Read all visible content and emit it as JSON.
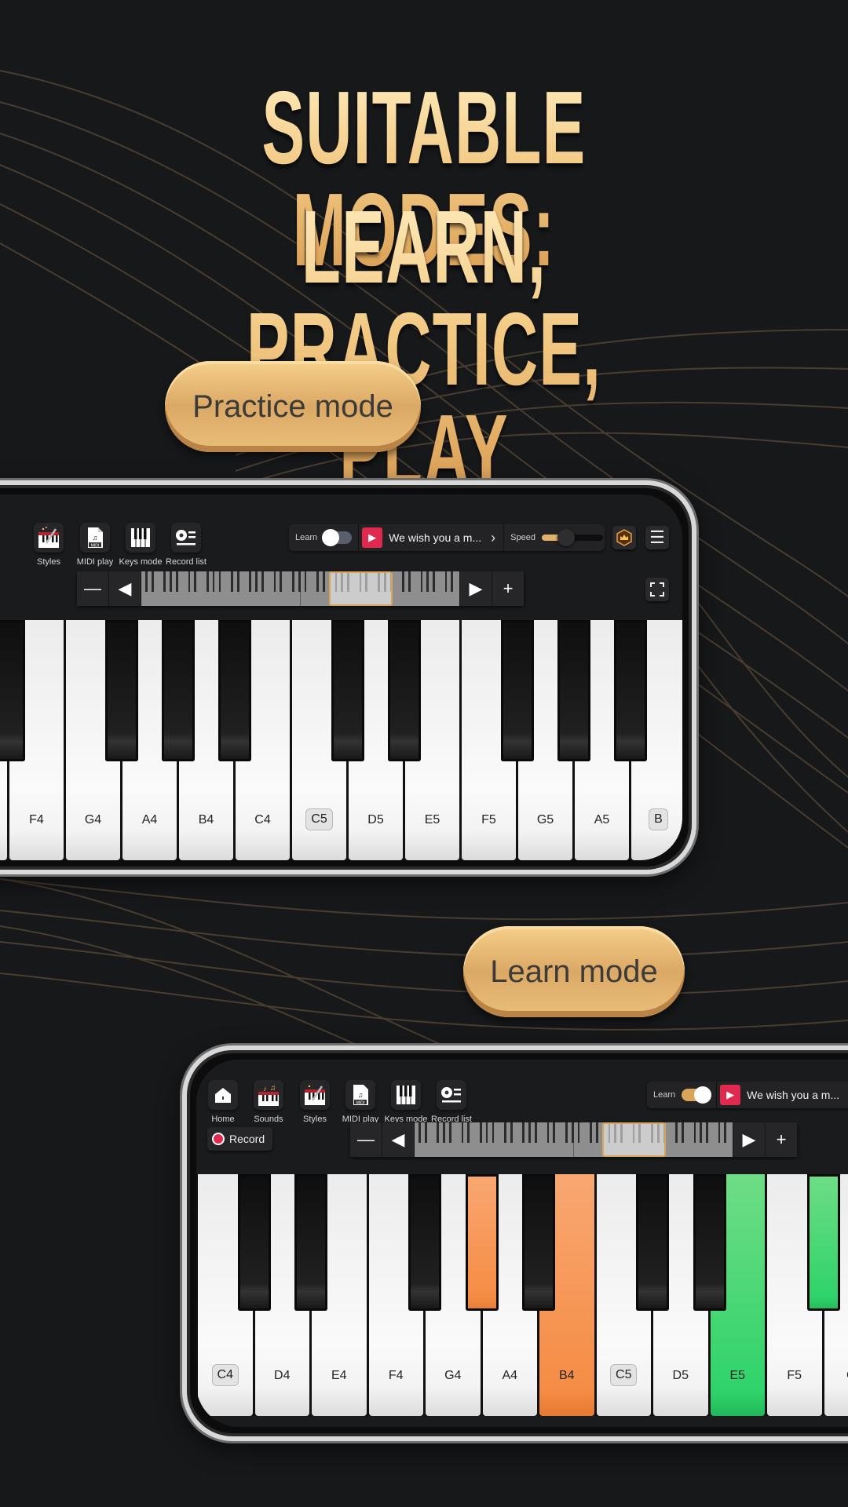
{
  "headline": {
    "line1": "SUITABLE MODES:",
    "line2": "LEARN, PRACTICE, PLAY"
  },
  "labels": {
    "practice_mode": "Practice mode",
    "learn_mode": "Learn mode"
  },
  "colors": {
    "background": "#17181a",
    "gold": "#dba965",
    "play_red": "#e0294f",
    "learn_orange": "#f7934c",
    "learn_green": "#2fd36b"
  },
  "practice_screen": {
    "toolbar": [
      {
        "label": "Styles",
        "icon": "piano-wand-icon"
      },
      {
        "label": "MIDI play",
        "icon": "midi-file-icon"
      },
      {
        "label": "Keys mode",
        "icon": "keys-icon"
      },
      {
        "label": "Record list",
        "icon": "record-list-icon"
      }
    ],
    "learn_label": "Learn",
    "learn_toggle_on": false,
    "song_title": "We wish you a m...",
    "speed_label": "Speed",
    "speed_value": 0.4,
    "keys": [
      {
        "note": "E4",
        "label": ""
      },
      {
        "note": "F4",
        "label": "F4"
      },
      {
        "note": "G4",
        "label": "G4"
      },
      {
        "note": "A4",
        "label": "A4"
      },
      {
        "note": "B4",
        "label": "B4"
      },
      {
        "note": "C5",
        "label": "C4"
      },
      {
        "note": "C5",
        "label": "C5",
        "boxed": true
      },
      {
        "note": "D5",
        "label": "D5"
      },
      {
        "note": "E5",
        "label": "E5"
      },
      {
        "note": "F5",
        "label": "F5"
      },
      {
        "note": "G5",
        "label": "G5"
      },
      {
        "note": "A5",
        "label": "A5"
      },
      {
        "note": "B5",
        "label": "B",
        "boxed": true
      }
    ]
  },
  "learn_screen": {
    "toolbar": [
      {
        "label": "Home",
        "icon": "home-icon"
      },
      {
        "label": "Sounds",
        "icon": "piano-notes-icon"
      },
      {
        "label": "Styles",
        "icon": "piano-wand-icon"
      },
      {
        "label": "MIDI play",
        "icon": "midi-file-icon"
      },
      {
        "label": "Keys mode",
        "icon": "keys-icon"
      },
      {
        "label": "Record list",
        "icon": "record-list-icon"
      }
    ],
    "record_label": "Record",
    "learn_label": "Learn",
    "learn_toggle_on": true,
    "song_title": "We wish you a m...",
    "keys": [
      {
        "label": "C4",
        "boxed": true
      },
      {
        "label": "D4"
      },
      {
        "label": "E4"
      },
      {
        "label": "F4"
      },
      {
        "label": "G4"
      },
      {
        "label": "A4"
      },
      {
        "label": "B4",
        "highlight": "orange"
      },
      {
        "label": "C5",
        "boxed": true
      },
      {
        "label": "D5"
      },
      {
        "label": "E5",
        "highlight": "green"
      },
      {
        "label": "F5"
      },
      {
        "label": "G"
      }
    ]
  }
}
